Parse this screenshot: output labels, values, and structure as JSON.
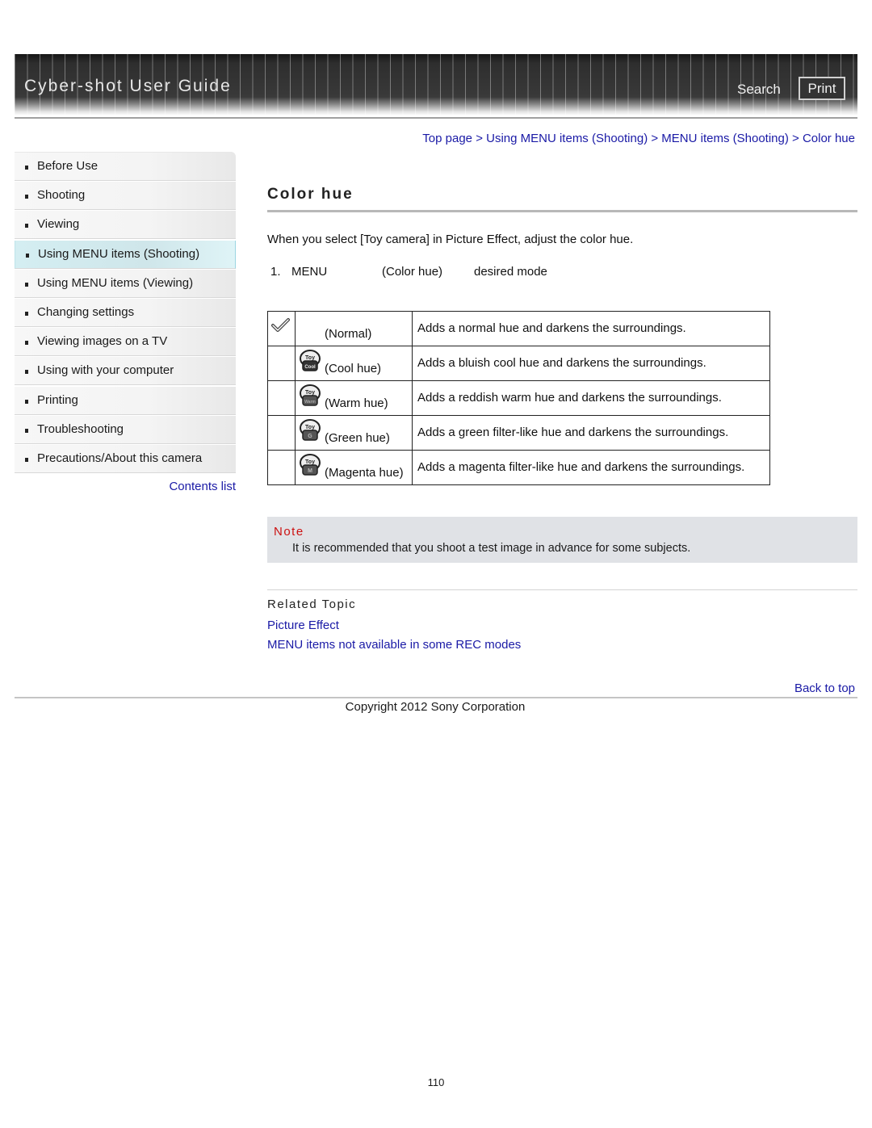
{
  "header": {
    "title": "Cyber-shot User Guide",
    "search_label": "Search",
    "print_label": "Print"
  },
  "breadcrumb": {
    "items": [
      "Top page",
      "Using MENU items (Shooting)",
      "MENU items (Shooting)",
      "Color hue"
    ],
    "separator": ">"
  },
  "sidebar": {
    "items": [
      {
        "label": "Before Use",
        "active": false
      },
      {
        "label": "Shooting",
        "active": false
      },
      {
        "label": "Viewing",
        "active": false
      },
      {
        "label": "Using MENU items (Shooting)",
        "active": true
      },
      {
        "label": "Using MENU items (Viewing)",
        "active": false
      },
      {
        "label": "Changing settings",
        "active": false
      },
      {
        "label": "Viewing images on a TV",
        "active": false
      },
      {
        "label": "Using with your computer",
        "active": false
      },
      {
        "label": "Printing",
        "active": false
      },
      {
        "label": "Troubleshooting",
        "active": false
      },
      {
        "label": "Precautions/About this camera",
        "active": false
      }
    ],
    "contents_list_label": "Contents list"
  },
  "main": {
    "title": "Color hue",
    "intro": "When you select [Toy camera] in Picture Effect, adjust the color hue.",
    "step": {
      "number": "1.",
      "part1": "MENU",
      "part2": "(Color hue)",
      "part3": "desired mode"
    },
    "modes": [
      {
        "icon": "checkmark-icon",
        "icon_text": "",
        "label": "(Normal)",
        "description": "Adds a normal hue and darkens the surroundings.",
        "default": true
      },
      {
        "icon": "toy-cool-icon",
        "icon_text": "Cool",
        "label": "(Cool hue)",
        "description": "Adds a bluish cool hue and darkens the surroundings.",
        "default": false
      },
      {
        "icon": "toy-warm-icon",
        "icon_text": "Warm",
        "label": "(Warm hue)",
        "description": "Adds a reddish warm hue and darkens the surroundings.",
        "default": false
      },
      {
        "icon": "toy-green-icon",
        "icon_text": "G",
        "label": "(Green hue)",
        "description": "Adds a green filter-like hue and darkens the surroundings.",
        "default": false
      },
      {
        "icon": "toy-magenta-icon",
        "icon_text": "M",
        "label": "(Magenta hue)",
        "description": "Adds a magenta filter-like hue and darkens the surroundings.",
        "default": false
      }
    ],
    "note": {
      "title": "Note",
      "text": "It is recommended that you shoot a test image in advance for some subjects."
    },
    "related": {
      "title": "Related Topic",
      "links": [
        "Picture Effect",
        "MENU items not available in some REC modes"
      ]
    }
  },
  "footer": {
    "back_to_top": "Back to top",
    "copyright": "Copyright 2012 Sony Corporation",
    "page_number": "110"
  },
  "colors": {
    "link": "#1a1aa6",
    "note_title": "#cc1111",
    "note_bg": "#e0e2e6",
    "active_nav": "#d4eef2"
  }
}
